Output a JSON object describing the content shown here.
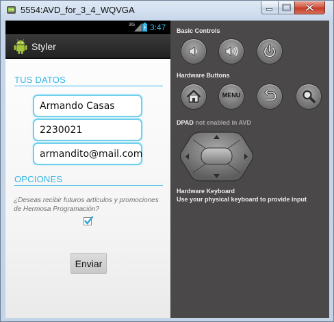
{
  "window": {
    "title": "5554:AVD_for_3_4_WQVGA"
  },
  "statusbar": {
    "network": "3G",
    "time": "3:47"
  },
  "app": {
    "title": "Styler",
    "section_data": "TUS DATOS",
    "fields": {
      "name": "Armando Casas",
      "phone": "2230021",
      "email": "armandito@mail.com"
    },
    "section_options": "OPCIONES",
    "question": "¿Deseas recibir futuros artículos y promociones de Hermosa Programación?",
    "newsletter_checked": true,
    "send_label": "Enviar"
  },
  "controls": {
    "basic_label": "Basic Controls",
    "hardware_label": "Hardware Buttons",
    "menu_label": "MENU",
    "dpad_label": "DPAD",
    "dpad_note": "not enabled in AVD",
    "keyboard_label": "Hardware Keyboard",
    "keyboard_note": "Use your physical keyboard to provide input"
  },
  "icons": [
    "emulator-app-icon",
    "minimize-icon",
    "maximize-icon",
    "close-icon",
    "signal-icon",
    "battery-icon",
    "android-icon",
    "checkbox-checked-icon",
    "volume-down-icon",
    "volume-up-icon",
    "power-icon",
    "home-icon",
    "back-icon",
    "search-icon",
    "dpad"
  ],
  "colors": {
    "accent": "#33b5e5",
    "panel": "#4a4848",
    "actionbar": "#2b2b2b",
    "close": "#c94a33"
  }
}
